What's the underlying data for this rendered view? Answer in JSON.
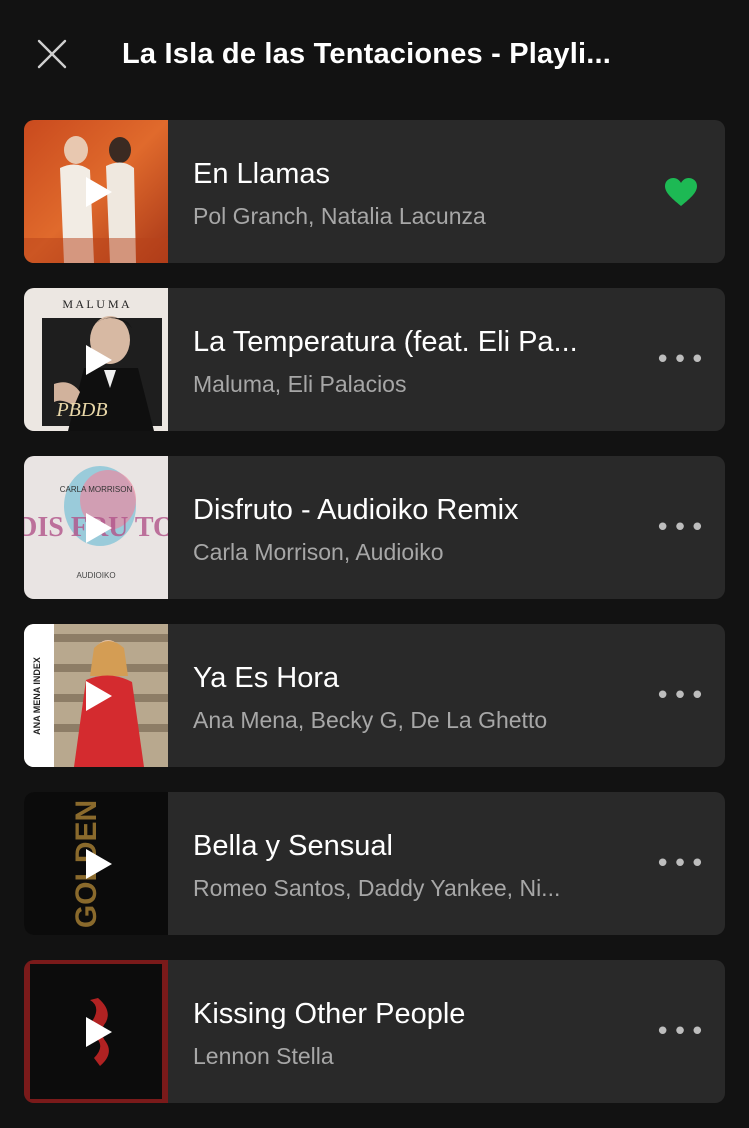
{
  "header": {
    "title": "La Isla de las Tentaciones - Playli...",
    "close_icon": "close-icon"
  },
  "colors": {
    "background": "#121212",
    "card": "#292929",
    "accent_green": "#1db954",
    "secondary_text": "#a7a7a7"
  },
  "tracks": [
    {
      "title": "En Llamas",
      "artists": "Pol Granch, Natalia Lacunza",
      "action": "heart-icon",
      "liked": true
    },
    {
      "title": "La Temperatura (feat. Eli Pa...",
      "artists": "Maluma, Eli Palacios",
      "action": "more-icon",
      "action_label": "•••"
    },
    {
      "title": "Disfruto - Audioiko Remix",
      "artists": "Carla Morrison, Audioiko",
      "action": "more-icon",
      "action_label": "•••"
    },
    {
      "title": "Ya Es Hora",
      "artists": "Ana Mena, Becky G, De La Ghetto",
      "action": "more-icon",
      "action_label": "•••"
    },
    {
      "title": "Bella y Sensual",
      "artists": "Romeo Santos, Daddy Yankee, Ni...",
      "action": "more-icon",
      "action_label": "•••"
    },
    {
      "title": "Kissing Other People",
      "artists": "Lennon Stella",
      "action": "more-icon",
      "action_label": "•••"
    }
  ],
  "album_art_text": {
    "maluma_top": "M A L U M A",
    "maluma_bottom": "PBDB",
    "carla_top": "CARLA MORRISON",
    "carla_big": "DIS FRU TO",
    "carla_bottom": "AUDIOIKO",
    "ana_side": "ANA MENA INDEX",
    "golden": "GOLDEN"
  }
}
